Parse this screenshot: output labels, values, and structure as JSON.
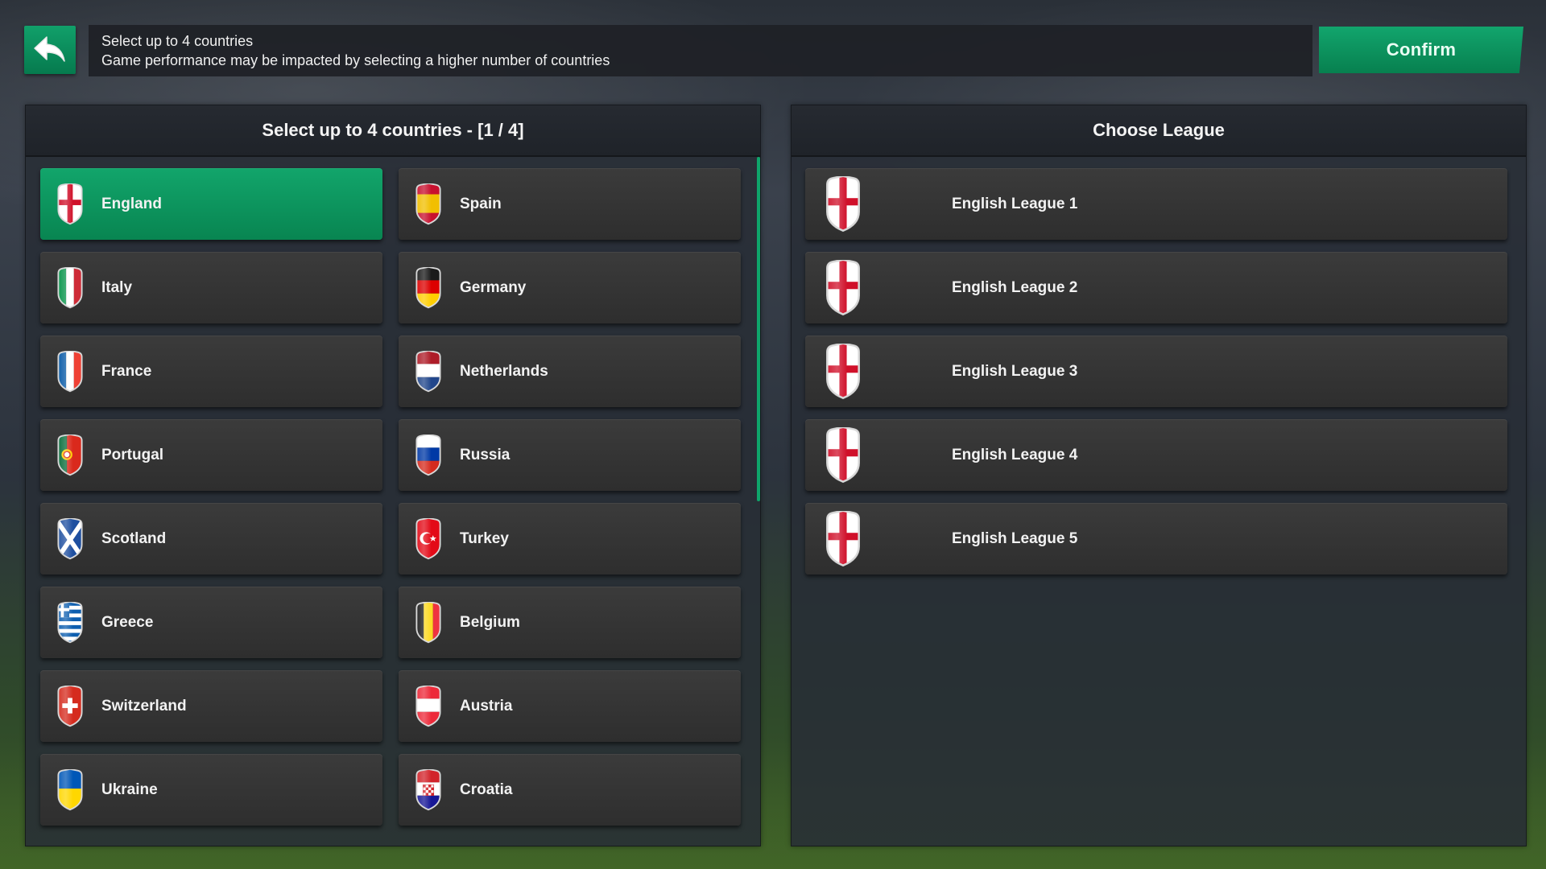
{
  "header": {
    "info_line1": "Select up to 4 countries",
    "info_line2": "Game performance may be impacted by selecting a higher number of countries",
    "confirm_label": "Confirm",
    "back_icon": "back-arrow-icon"
  },
  "countries_panel": {
    "title": "Select up to 4 countries - [1 / 4]",
    "selected": "England",
    "items": [
      {
        "label": "England",
        "icon": "england-flag-icon"
      },
      {
        "label": "Spain",
        "icon": "spain-flag-icon"
      },
      {
        "label": "Italy",
        "icon": "italy-flag-icon"
      },
      {
        "label": "Germany",
        "icon": "germany-flag-icon"
      },
      {
        "label": "France",
        "icon": "france-flag-icon"
      },
      {
        "label": "Netherlands",
        "icon": "netherlands-flag-icon"
      },
      {
        "label": "Portugal",
        "icon": "portugal-flag-icon"
      },
      {
        "label": "Russia",
        "icon": "russia-flag-icon"
      },
      {
        "label": "Scotland",
        "icon": "scotland-flag-icon"
      },
      {
        "label": "Turkey",
        "icon": "turkey-flag-icon"
      },
      {
        "label": "Greece",
        "icon": "greece-flag-icon"
      },
      {
        "label": "Belgium",
        "icon": "belgium-flag-icon"
      },
      {
        "label": "Switzerland",
        "icon": "switzerland-flag-icon"
      },
      {
        "label": "Austria",
        "icon": "austria-flag-icon"
      },
      {
        "label": "Ukraine",
        "icon": "ukraine-flag-icon"
      },
      {
        "label": "Croatia",
        "icon": "croatia-flag-icon"
      }
    ]
  },
  "league_panel": {
    "title": "Choose League",
    "items": [
      {
        "label": "English League 1",
        "icon": "england-flag-icon"
      },
      {
        "label": "English League 2",
        "icon": "england-flag-icon"
      },
      {
        "label": "English League 3",
        "icon": "england-flag-icon"
      },
      {
        "label": "English League 4",
        "icon": "england-flag-icon"
      },
      {
        "label": "English League 5",
        "icon": "england-flag-icon"
      }
    ]
  },
  "colors": {
    "accent_green": "#0ea56b",
    "button_dark": "#343434",
    "panel_bg": "#282d36"
  }
}
